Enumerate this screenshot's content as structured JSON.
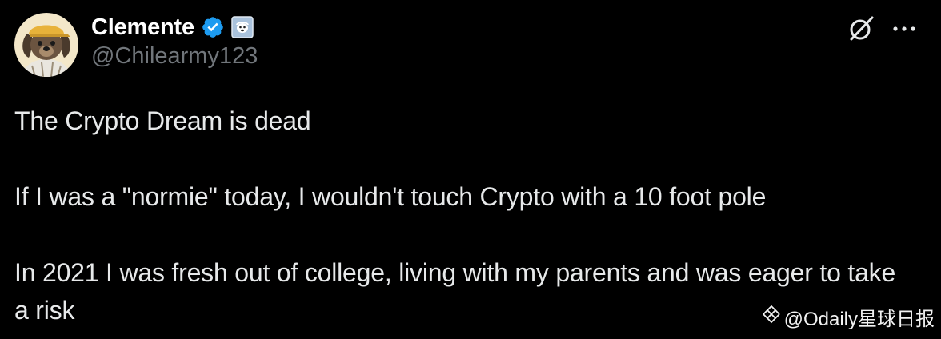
{
  "tweet": {
    "author": {
      "display_name": "Clemente",
      "handle": "@Chilearmy123",
      "avatar_icon": "cartoon-dog-avatar",
      "verified_icon": "verified-badge-icon",
      "affiliate_icon": "affiliate-badge-icon"
    },
    "actions": {
      "grok_icon": "grok-icon",
      "more_icon": "more-options-icon"
    },
    "body": {
      "line1": "The Crypto Dream is dead",
      "line2": "If I was a \"normie\" today, I wouldn't touch Crypto with a 10 foot pole",
      "line3": "In 2021 I was fresh out of college, living with my parents and was eager to take a risk"
    }
  },
  "watermark": {
    "text": "@Odaily星球日报",
    "icon": "odaily-logo-icon"
  },
  "colors": {
    "background": "#000000",
    "text_primary": "#e7e9ea",
    "text_secondary": "#71767b",
    "verified_blue": "#1d9bf0"
  }
}
